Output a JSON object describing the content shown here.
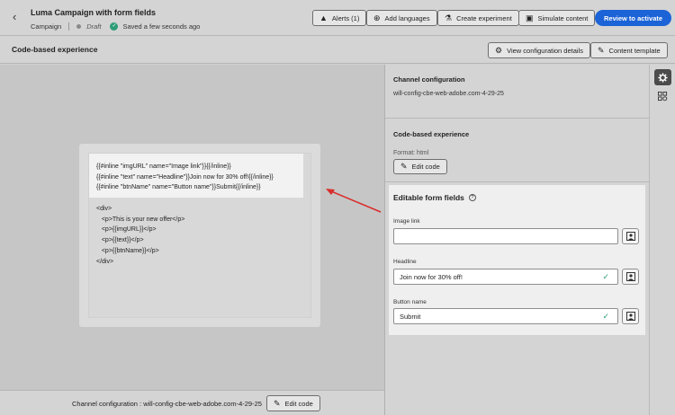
{
  "header": {
    "title": "Luma Campaign with form fields",
    "type": "Campaign",
    "status": "Draft",
    "saved": "Saved a few seconds ago",
    "buttons": {
      "alerts": "Alerts (1)",
      "add_languages": "Add languages",
      "create_experiment": "Create experiment",
      "simulate_content": "Simulate content",
      "review": "Review to activate"
    }
  },
  "subheader": {
    "title": "Code-based experience",
    "view_config": "View configuration details",
    "content_template": "Content template"
  },
  "editor": {
    "inline_lines": [
      "{{#inline \"imgURL\" name=\"Image link\"}}{{/inline}}",
      "{{#inline \"text\" name=\"Headline\"}}Join now for 30% off!{{/inline}}",
      "{{#inline \"btnName\" name=\"Button name\"}}Submit{{/inline}}"
    ],
    "code_lines": [
      "<div>",
      "   <p>This is your new offer</p>",
      "   <p>{{imgURL}}</p>",
      "   <p>{{text}}</p>",
      "   <p>{{btnName}}</p>",
      "</div>"
    ]
  },
  "footer": {
    "label": "Channel configuration : will-config-cbe-web-adobe.com-4-29-25",
    "edit_code": "Edit code"
  },
  "panel": {
    "channel_config_title": "Channel configuration",
    "channel_config_value": "will-config-cbe-web-adobe.com-4-29-25",
    "cbe_title": "Code-based experience",
    "format": "Format: html",
    "edit_code": "Edit code",
    "form": {
      "title": "Editable form fields",
      "fields": [
        {
          "label": "Image link",
          "value": ""
        },
        {
          "label": "Headline",
          "value": "Join now for 30% off!"
        },
        {
          "label": "Button name",
          "value": "Submit"
        }
      ]
    }
  },
  "colors": {
    "primary": "#1b63d6",
    "success": "#2d9d78",
    "arrow": "#d92c2c"
  }
}
